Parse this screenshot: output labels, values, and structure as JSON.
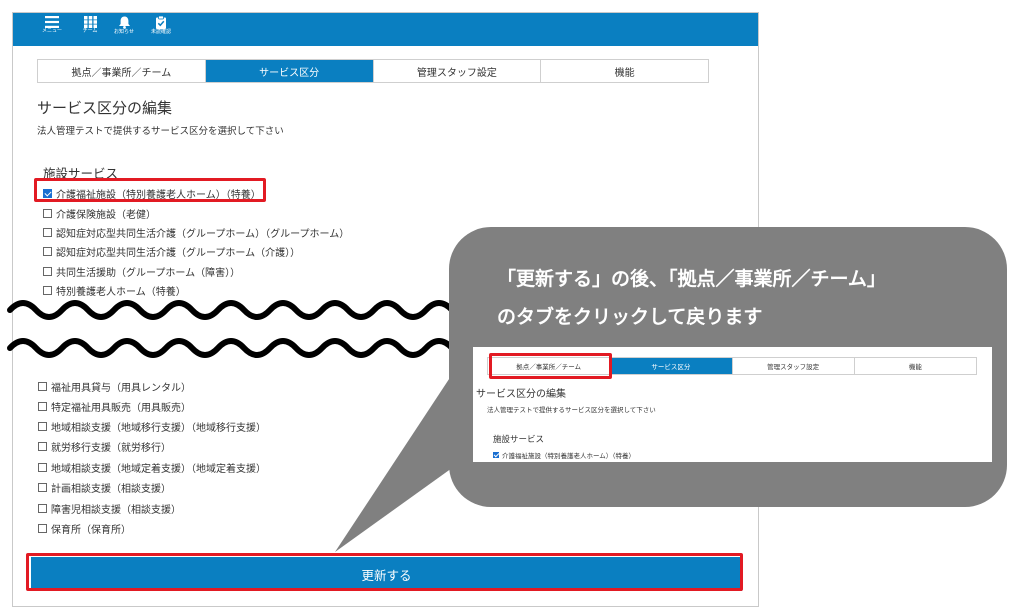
{
  "nav": {
    "menu": "メニュー",
    "team": "チーム",
    "notice": "お知らせ",
    "unconfirmed": "未読確認"
  },
  "tabs": [
    {
      "label": "拠点／事業所／チーム",
      "active": false
    },
    {
      "label": "サービス区分",
      "active": true
    },
    {
      "label": "管理スタッフ設定",
      "active": false
    },
    {
      "label": "機能",
      "active": false
    }
  ],
  "page": {
    "title": "サービス区分の編集",
    "description": "法人管理テストで提供するサービス区分を選択して下さい",
    "section": "施設サービス"
  },
  "services_top": [
    {
      "label": "介護福祉施設（特別養護老人ホーム）（特養）",
      "checked": true
    },
    {
      "label": "介護保険施設（老健）",
      "checked": false
    },
    {
      "label": "認知症対応型共同生活介護（グループホーム）（グループホーム）",
      "checked": false
    },
    {
      "label": "認知症対応型共同生活介護（グループホーム（介護））",
      "checked": false
    },
    {
      "label": "共同生活援助（グループホーム（障害））",
      "checked": false
    },
    {
      "label": "特別養護老人ホーム（特養）",
      "checked": false
    }
  ],
  "services_bottom": [
    {
      "label": "福祉用具貸与（用具レンタル）",
      "checked": false
    },
    {
      "label": "特定福祉用具販売（用具販売）",
      "checked": false
    },
    {
      "label": "地域相談支援（地域移行支援）（地域移行支援）",
      "checked": false
    },
    {
      "label": "就労移行支援（就労移行）",
      "checked": false
    },
    {
      "label": "地域相談支援（地域定着支援）（地域定着支援）",
      "checked": false
    },
    {
      "label": "計画相談支援（相談支援）",
      "checked": false
    },
    {
      "label": "障害児相談支援（相談支援）",
      "checked": false
    },
    {
      "label": "保育所（保育所）",
      "checked": false
    }
  ],
  "update_button": "更新する",
  "callout": {
    "line1": "「更新する」の後、「拠点／事業所／チーム」",
    "line2": "のタブをクリックして戻ります"
  },
  "mini": {
    "tabs": [
      {
        "label": "拠点／事業所／チーム",
        "active": false
      },
      {
        "label": "サービス区分",
        "active": true
      },
      {
        "label": "管理スタッフ設定",
        "active": false
      },
      {
        "label": "機能",
        "active": false
      }
    ],
    "title": "サービス区分の編集",
    "description": "法人管理テストで提供するサービス区分を選択して下さい",
    "section": "施設サービス",
    "checkbox": "介護福祉施設（特別養護老人ホーム）（特養）"
  },
  "colors": {
    "accent": "#0a7fc1",
    "highlight": "#e21a23",
    "callout": "#808080"
  }
}
